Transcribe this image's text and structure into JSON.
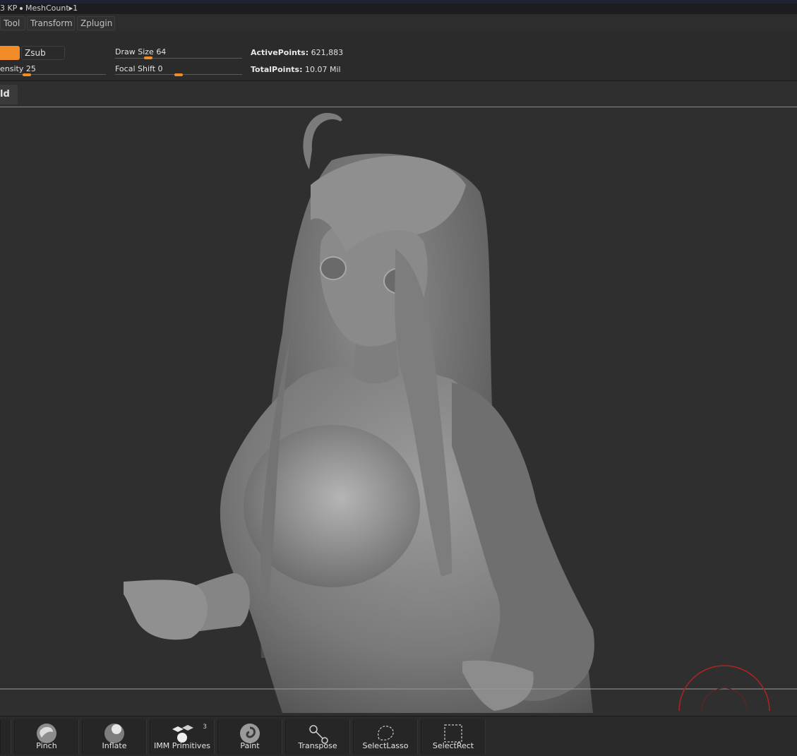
{
  "topbar": {
    "kp_text": "3 KP",
    "meshcount_text": "MeshCount▸1"
  },
  "menu": {
    "items": [
      "Tool",
      "Transform",
      "Zplugin"
    ]
  },
  "shelf": {
    "zsub_label": "Zsub",
    "draw_size": {
      "label": "Draw Size",
      "value": "64",
      "fraction": 0.26
    },
    "intensity": {
      "label": "ensity",
      "value": "25",
      "fraction": 0.25
    },
    "focal_shift": {
      "label": "Focal Shift",
      "value": "0",
      "fraction": 0.5
    },
    "active_points": {
      "label": "ActivePoints:",
      "value": "621,883"
    },
    "total_points": {
      "label": "TotalPoints:",
      "value": "10.07 Mil"
    }
  },
  "tab": {
    "label": "ld"
  },
  "brushes": [
    {
      "label": "Pinch",
      "icon": "pinch-brush-icon"
    },
    {
      "label": "Inflate",
      "icon": "inflate-brush-icon"
    },
    {
      "label": "IMM Primitives",
      "icon": "imm-primitives-icon",
      "badge": "3"
    },
    {
      "label": "Paint",
      "icon": "paint-brush-icon"
    },
    {
      "label": "Transpose",
      "icon": "transpose-icon"
    },
    {
      "label": "SelectLasso",
      "icon": "select-lasso-icon"
    },
    {
      "label": "SelectRect",
      "icon": "select-rect-icon"
    }
  ],
  "colors": {
    "accent": "#f28c28",
    "background": "#2f2f2f",
    "panel": "#2b2b2b"
  }
}
